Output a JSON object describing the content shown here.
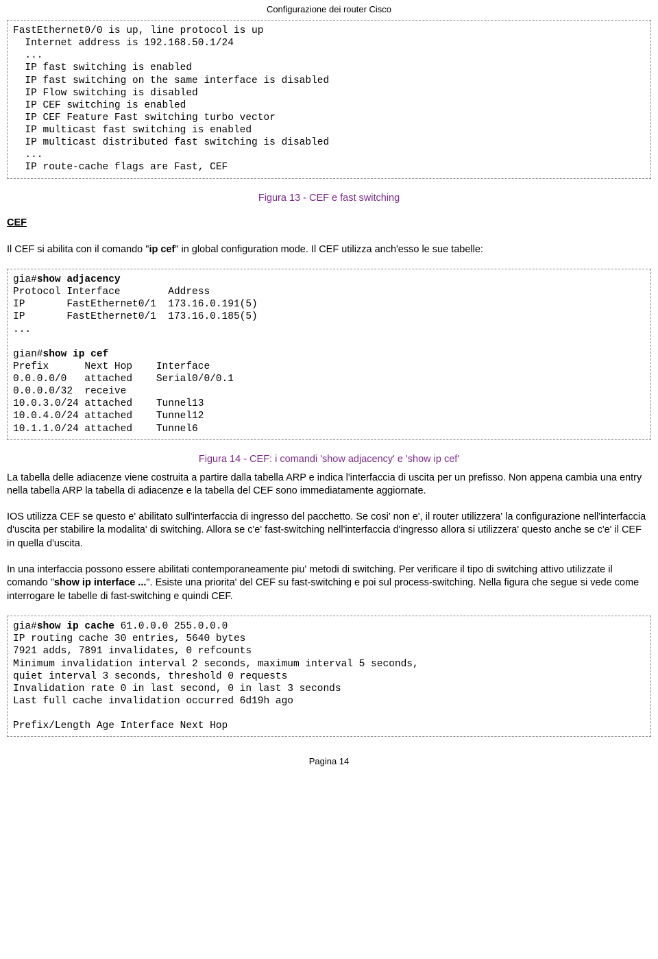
{
  "header": {
    "title": "Configurazione dei router Cisco"
  },
  "codebox1": {
    "l1": "FastEthernet0/0 is up, line protocol is up",
    "l2": "  Internet address is 192.168.50.1/24",
    "l3": "  ...",
    "l4": "  IP fast switching is enabled",
    "l5": "  IP fast switching on the same interface is disabled",
    "l6": "  IP Flow switching is disabled",
    "l7": "  IP CEF switching is enabled",
    "l8": "  IP CEF Feature Fast switching turbo vector",
    "l9": "  IP multicast fast switching is enabled",
    "l10": "  IP multicast distributed fast switching is disabled",
    "l11": "  ...",
    "l12": "  IP route-cache flags are Fast, CEF"
  },
  "caption1": "Figura 13 - CEF e fast switching",
  "section": {
    "cef": "CEF"
  },
  "para1a": "Il CEF si abilita con il comando \"",
  "para1b": "ip cef",
  "para1c": "\" in global configuration mode. Il CEF utilizza anch'esso le sue tabelle:",
  "codebox2": {
    "l1a": "gia#",
    "l1b": "show adjacency",
    "l2": "Protocol Interface        Address",
    "l3": "IP       FastEthernet0/1  173.16.0.191(5)",
    "l4": "IP       FastEthernet0/1  173.16.0.185(5)",
    "l5": "...",
    "blank": "",
    "l6a": "gian#",
    "l6b": "show ip cef",
    "l7": "Prefix      Next Hop    Interface",
    "l8": "0.0.0.0/0   attached    Serial0/0/0.1",
    "l9": "0.0.0.0/32  receive",
    "l10": "10.0.3.0/24 attached    Tunnel13",
    "l11": "10.0.4.0/24 attached    Tunnel12",
    "l12": "10.1.1.0/24 attached    Tunnel6"
  },
  "caption2": "Figura 14 - CEF: i comandi 'show adjacency' e 'show ip cef'",
  "para2": "  La tabella delle adiacenze viene costruita a partire dalla tabella ARP e indica l'interfaccia di uscita per un prefisso. Non appena cambia una entry nella tabella ARP la tabella di adiacenze e la tabella del CEF sono immediatamente aggiornate.",
  "para3": "   IOS utilizza CEF se questo e' abilitato sull'interfaccia di ingresso del pacchetto. Se cosi' non e', il router utilizzera' la configurazione nell'interfaccia d'uscita per stabilire la modalita' di switching. Allora se c'e' fast-switching nell'interfaccia d'ingresso allora si utilizzera' questo anche se c'e' il CEF in quella d'uscita.",
  "para4a": "    In una interfaccia possono essere abilitati contemporaneamente piu' metodi di switching. Per verificare il tipo di switching attivo utilizzate il comando \"",
  "para4b": "show ip interface ...",
  "para4c": "\". Esiste una priorita' del CEF su fast-switching e poi sul process-switching. Nella figura che segue si vede come interrogare le tabelle di fast-switching e quindi CEF.",
  "codebox3": {
    "l1a": "gia#",
    "l1b": "show ip cache",
    "l1c": " 61.0.0.0 255.0.0.0",
    "l2": "IP routing cache 30 entries, 5640 bytes",
    "l3": "7921 adds, 7891 invalidates, 0 refcounts",
    "l4": "Minimum invalidation interval 2 seconds, maximum interval 5 seconds,",
    "l5": "quiet interval 3 seconds, threshold 0 requests",
    "l6": "Invalidation rate 0 in last second, 0 in last 3 seconds",
    "l7": "Last full cache invalidation occurred 6d19h ago",
    "blank": "",
    "l8": "Prefix/Length Age Interface Next Hop"
  },
  "footer": {
    "page": "Pagina 14"
  }
}
